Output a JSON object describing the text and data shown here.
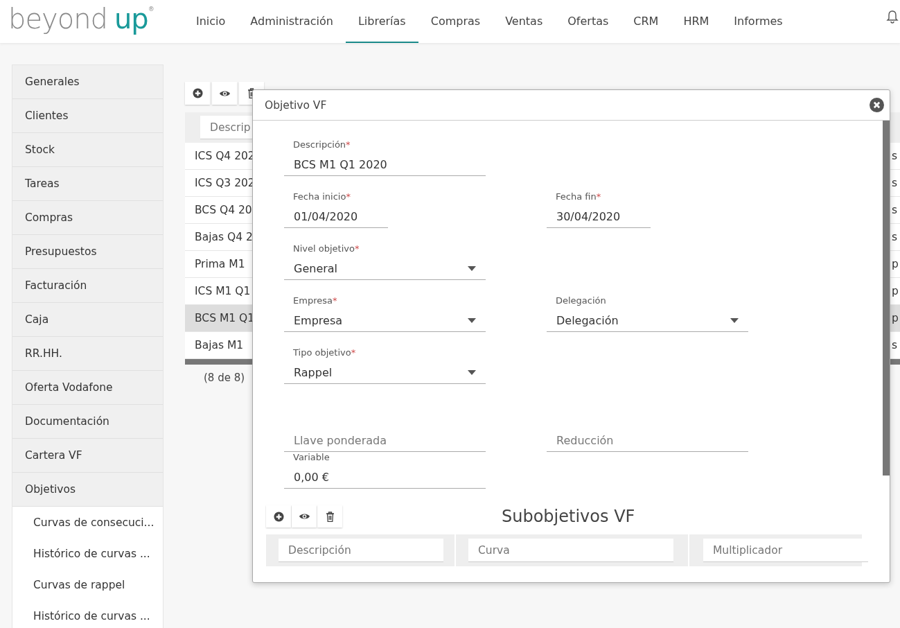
{
  "logo": {
    "text_main": "beyond",
    "text_accent": "up",
    "mark": "®"
  },
  "nav": [
    {
      "label": "Inicio",
      "selected": false
    },
    {
      "label": "Administración",
      "selected": false
    },
    {
      "label": "Librerías",
      "selected": true
    },
    {
      "label": "Compras",
      "selected": false
    },
    {
      "label": "Ventas",
      "selected": false
    },
    {
      "label": "Ofertas",
      "selected": false
    },
    {
      "label": "CRM",
      "selected": false
    },
    {
      "label": "HRM",
      "selected": false
    },
    {
      "label": "Informes",
      "selected": false
    }
  ],
  "sidebar": {
    "items": [
      {
        "label": "Generales"
      },
      {
        "label": "Clientes"
      },
      {
        "label": "Stock"
      },
      {
        "label": "Tareas"
      },
      {
        "label": "Compras"
      },
      {
        "label": "Presupuestos"
      },
      {
        "label": "Facturación"
      },
      {
        "label": "Caja"
      },
      {
        "label": "RR.HH."
      },
      {
        "label": "Oferta Vodafone"
      },
      {
        "label": "Documentación"
      },
      {
        "label": "Cartera VF"
      },
      {
        "label": "Objetivos",
        "children": [
          {
            "label": "Curvas de consecuci..."
          },
          {
            "label": "Histórico de curvas ..."
          },
          {
            "label": "Curvas de rappel"
          },
          {
            "label": "Histórico de curvas ..."
          }
        ]
      }
    ]
  },
  "table": {
    "filter_placeholder": "Descrip",
    "rows": [
      {
        "column_1": "ICS Q4 202",
        "column_2": "s",
        "selected": false
      },
      {
        "column_1": "ICS Q3 202",
        "column_2": "s",
        "selected": false
      },
      {
        "column_1": "BCS Q4 20",
        "column_2": "s",
        "selected": false
      },
      {
        "column_1": "Bajas Q4 2",
        "column_2": "s",
        "selected": false
      },
      {
        "column_1": "Prima M1",
        "column_2": "p",
        "selected": false
      },
      {
        "column_1": "ICS M1 Q1",
        "column_2": "p",
        "selected": false
      },
      {
        "column_1": "BCS M1 Q1",
        "column_2": "p",
        "selected": true
      },
      {
        "column_1": "Bajas M1",
        "column_2": "s",
        "selected": false
      }
    ],
    "footer": "(8 de 8)"
  },
  "toolbar": [
    {
      "kind": "add"
    },
    {
      "kind": "view"
    },
    {
      "kind": "delete"
    }
  ],
  "dialog": {
    "title": "Objetivo VF",
    "required_mark": "*",
    "rows": [
      [
        {
          "label": "Descripción",
          "required": true,
          "kind": "text",
          "value": "BCS M1 Q1 2020"
        }
      ],
      [
        {
          "label": "Fecha inicio",
          "required": true,
          "kind": "date",
          "value": "01/04/2020"
        },
        {
          "label": "Fecha fin",
          "required": true,
          "kind": "date",
          "value": "30/04/2020"
        }
      ],
      [
        {
          "label": "Nivel objetivo",
          "required": true,
          "kind": "select",
          "value": "General"
        }
      ],
      [
        {
          "label": "Empresa",
          "required": true,
          "kind": "select",
          "value": "Empresa"
        },
        {
          "label": "Delegación",
          "required": false,
          "kind": "select",
          "value": "Delegación"
        }
      ],
      [
        {
          "label": "Tipo objetivo",
          "required": true,
          "kind": "select",
          "value": "Rappel"
        }
      ],
      [
        {
          "kind": "text",
          "placeholder": "Llave ponderada"
        },
        {
          "kind": "text",
          "placeholder": "Reducción"
        }
      ],
      [
        {
          "label": "Variable",
          "required": false,
          "kind": "text",
          "value": "0,00 €"
        }
      ]
    ],
    "sub_toolbar": [
      {
        "kind": "add"
      },
      {
        "kind": "view"
      },
      {
        "kind": "delete"
      }
    ],
    "sub_title": "Subobjetivos VF",
    "sub_filters": [
      {
        "placeholder": "Descripción"
      },
      {
        "placeholder": "Curva"
      },
      {
        "placeholder": "Multiplicador"
      }
    ]
  }
}
